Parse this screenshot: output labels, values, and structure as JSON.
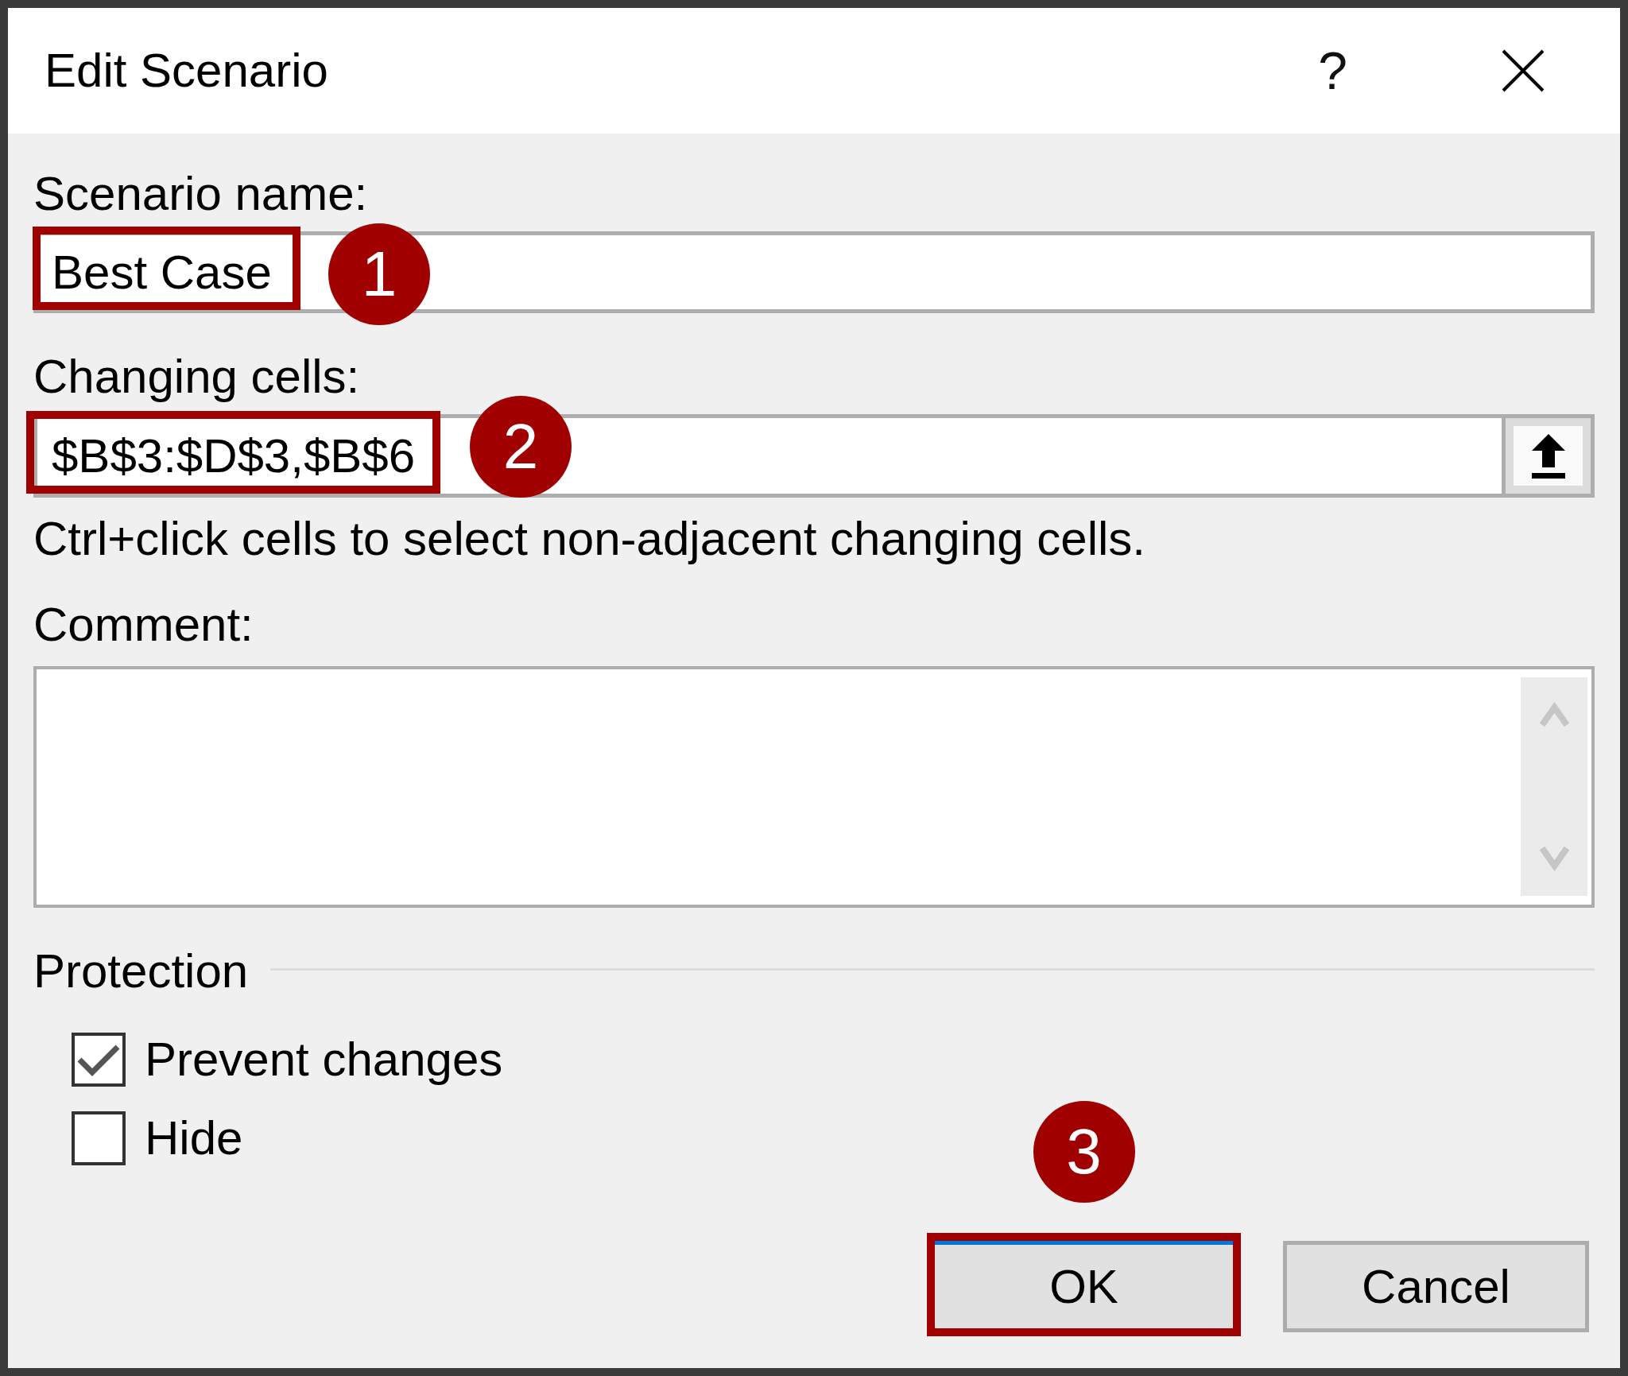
{
  "window": {
    "title": "Edit Scenario",
    "help_button": "?"
  },
  "scenario_name": {
    "label": "Scenario name:",
    "value": "Best Case",
    "highlighted": true,
    "callout": "1"
  },
  "changing_cells": {
    "label": "Changing cells:",
    "value": "$B$3:$D$3,$B$6",
    "highlighted": true,
    "callout": "2",
    "hint": "Ctrl+click cells to select non-adjacent changing cells."
  },
  "comment": {
    "label": "Comment:"
  },
  "protection": {
    "title": "Protection",
    "options": [
      {
        "label": "Prevent changes",
        "checked": true
      },
      {
        "label": "Hide",
        "checked": false
      }
    ]
  },
  "buttons": [
    {
      "label": "OK",
      "default": true,
      "highlighted": true,
      "callout": "3"
    },
    {
      "label": "Cancel",
      "default": false,
      "highlighted": false
    }
  ]
}
